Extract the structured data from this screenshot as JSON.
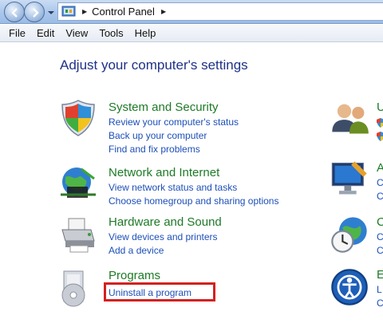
{
  "window": {
    "breadcrumb": [
      "Control Panel"
    ]
  },
  "menu": [
    "File",
    "Edit",
    "View",
    "Tools",
    "Help"
  ],
  "page": {
    "title": "Adjust your computer's settings"
  },
  "categories": [
    {
      "title": "System and Security",
      "icon": "shield-icon",
      "links": [
        "Review your computer's status",
        "Back up your computer",
        "Find and fix problems"
      ]
    },
    {
      "title": "Network and Internet",
      "icon": "network-globe-icon",
      "links": [
        "View network status and tasks",
        "Choose homegroup and sharing options"
      ]
    },
    {
      "title": "Hardware and Sound",
      "icon": "printer-icon",
      "links": [
        "View devices and printers",
        "Add a device"
      ]
    },
    {
      "title": "Programs",
      "icon": "programs-disc-icon",
      "links": [
        "Uninstall a program"
      ]
    }
  ],
  "right_column": [
    {
      "title": "U",
      "icon": "users-icon",
      "links": [
        "",
        ""
      ]
    },
    {
      "title": "A",
      "icon": "monitor-paint-icon",
      "links": [
        "C",
        "C"
      ]
    },
    {
      "title": "C",
      "icon": "clock-globe-icon",
      "links": [
        "C",
        "C"
      ]
    },
    {
      "title": "E",
      "icon": "ease-of-access-icon",
      "links": [
        "L",
        "C"
      ]
    }
  ],
  "colors": {
    "title_blue": "#1e3287",
    "category_green": "#1d7a26",
    "link_blue": "#1d4fb8",
    "highlight_red": "#d42020"
  }
}
